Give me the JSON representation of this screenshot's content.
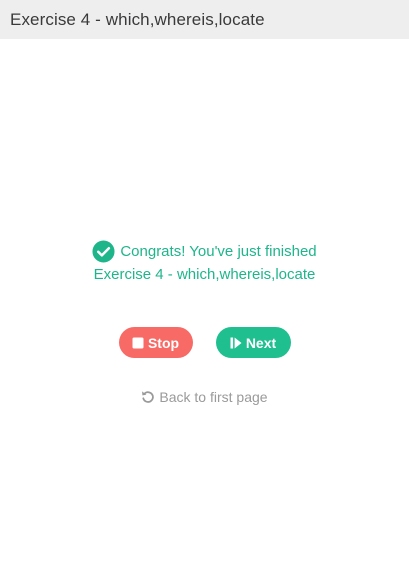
{
  "header": {
    "title": "Exercise 4 - which,whereis,locate"
  },
  "result": {
    "congrats_text": "Congrats! You've just finished",
    "exercise_name": "Exercise 4 - which,whereis,locate",
    "icon": "check-circle-icon",
    "color": "#1fb58a"
  },
  "actions": {
    "stop_label": "Stop",
    "stop_icon": "stop-square-icon",
    "stop_color": "#f86a66",
    "next_label": "Next",
    "next_icon": "skip-next-icon",
    "next_color": "#1fbf8f"
  },
  "back": {
    "label": "Back to first page",
    "icon": "undo-icon"
  }
}
